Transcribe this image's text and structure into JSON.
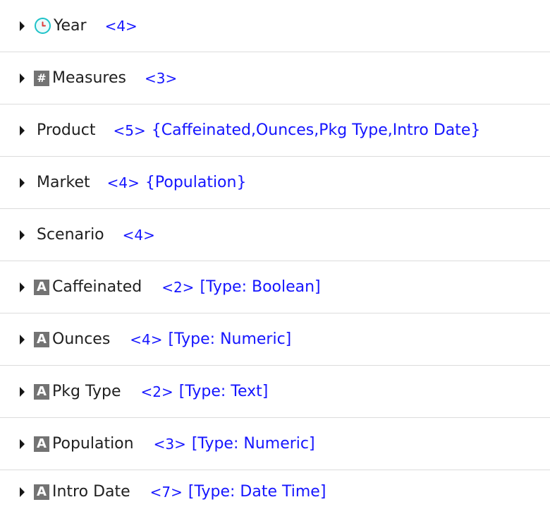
{
  "rows": [
    {
      "icon": "clock-icon",
      "name": "Year",
      "count": "<4>",
      "extra": ""
    },
    {
      "icon": "hash-icon",
      "icon_text": "#",
      "name": "Measures",
      "count": "<3>",
      "extra": ""
    },
    {
      "icon": "",
      "name": "Product",
      "count": "<5>",
      "extra": "{Caffeinated,Ounces,Pkg Type,Intro Date}"
    },
    {
      "icon": "",
      "name": "Market",
      "count": "<4>",
      "extra": "{Population}"
    },
    {
      "icon": "",
      "name": "Scenario",
      "count": "<4>",
      "extra": ""
    },
    {
      "icon": "attribute-icon",
      "icon_text": "A",
      "name": "Caffeinated",
      "count": "<2>",
      "extra": "[Type: Boolean]"
    },
    {
      "icon": "attribute-icon",
      "icon_text": "A",
      "name": "Ounces",
      "count": "<4>",
      "extra": "[Type: Numeric]"
    },
    {
      "icon": "attribute-icon",
      "icon_text": "A",
      "name": "Pkg Type",
      "count": "<2>",
      "extra": "[Type: Text]"
    },
    {
      "icon": "attribute-icon",
      "icon_text": "A",
      "name": "Population",
      "count": "<3>",
      "extra": "[Type: Numeric]"
    },
    {
      "icon": "attribute-icon",
      "icon_text": "A",
      "name": "Intro Date",
      "count": "<7>",
      "extra": "[Type: Date Time]"
    }
  ],
  "colors": {
    "count_blue": "#1515ff",
    "icon_gray": "#737373",
    "clock_teal": "#1ec2c8"
  }
}
